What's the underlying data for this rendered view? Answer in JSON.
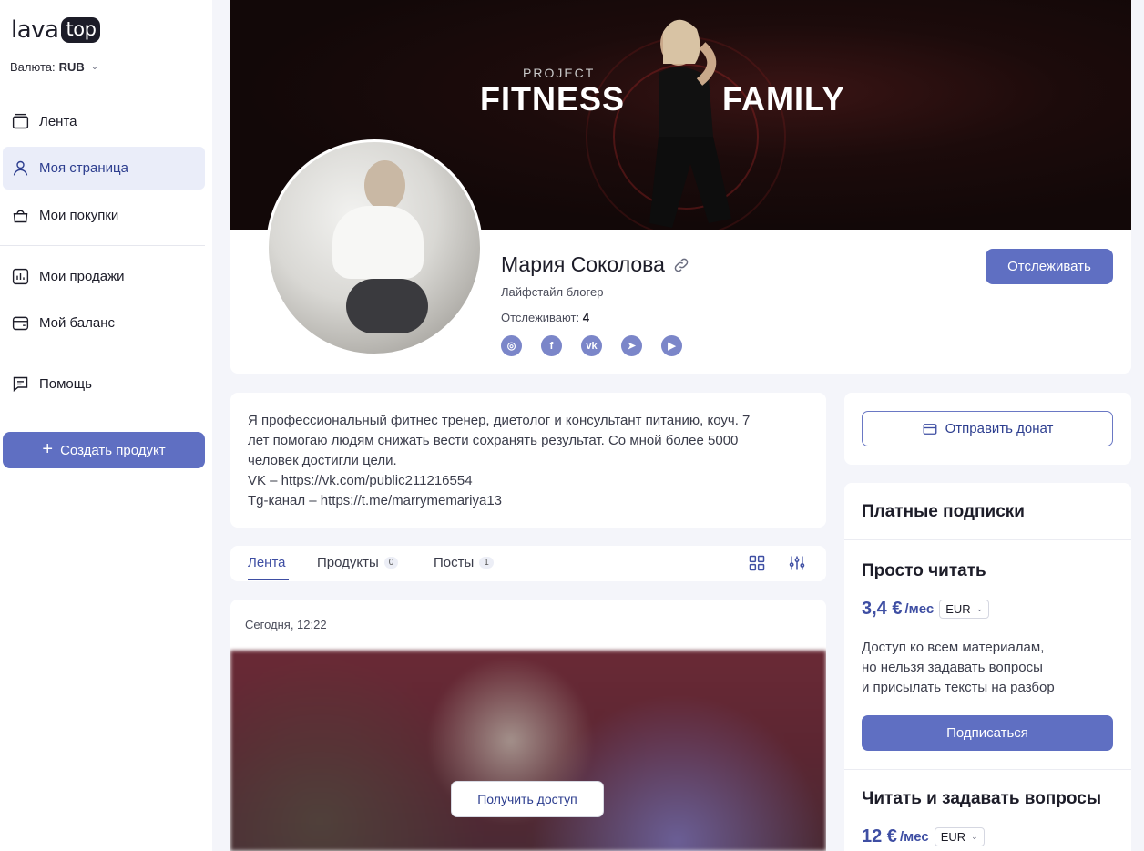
{
  "brand": {
    "logo_text": "lava",
    "logo_badge": "top"
  },
  "currency": {
    "label": "Валюта:",
    "value": "RUB"
  },
  "sidebar": {
    "items": [
      {
        "label": "Лента",
        "icon": "feed-icon"
      },
      {
        "label": "Моя страница",
        "icon": "user-icon",
        "active": true
      },
      {
        "label": "Мои покупки",
        "icon": "bag-icon"
      },
      {
        "label": "Мои продажи",
        "icon": "chart-icon"
      },
      {
        "label": "Мой баланс",
        "icon": "wallet-icon"
      },
      {
        "label": "Помощь",
        "icon": "chat-icon"
      }
    ],
    "create_button": "Создать продукт"
  },
  "banner": {
    "line1": "PROJECT",
    "word1": "FITNESS",
    "word2": "FAMILY"
  },
  "profile": {
    "name": "Мария Соколова",
    "role": "Лайфстайл блогер",
    "followers_label": "Отслеживают:",
    "followers_count": "4",
    "follow_button": "Отслеживать",
    "socials": [
      {
        "name": "instagram-icon",
        "glyph": "◎"
      },
      {
        "name": "facebook-icon",
        "glyph": "f"
      },
      {
        "name": "vk-icon",
        "glyph": "vk"
      },
      {
        "name": "telegram-icon",
        "glyph": "➤"
      },
      {
        "name": "youtube-icon",
        "glyph": "▶"
      }
    ]
  },
  "about": {
    "lines": [
      "Я профессиональный фитнес тренер, диетолог и консультант питанию, коуч. 7",
      "лет помогаю людям снижать вести сохранять результат. Со мной более 5000",
      "человек достигли цели.",
      "VK – https://vk.com/public211216554",
      "Tg-канал – https://t.me/marrymemariya13"
    ]
  },
  "tabs": [
    {
      "label": "Лента",
      "count": ""
    },
    {
      "label": "Продукты",
      "count": "0"
    },
    {
      "label": "Посты",
      "count": "1"
    }
  ],
  "post": {
    "date": "Сегодня, 12:22",
    "access_button": "Получить доступ"
  },
  "donate": {
    "button": "Отправить донат"
  },
  "subscriptions": {
    "title": "Платные подписки",
    "plans": [
      {
        "name": "Просто читать",
        "price": "3,4 €",
        "period": "/мес",
        "currency": "EUR",
        "description": [
          "Доступ ко всем материалам,",
          "но нельзя задавать вопросы",
          "и присылать тексты на разбор"
        ],
        "button": "Подписаться"
      },
      {
        "name": "Читать и задавать вопросы",
        "price": "12 €",
        "period": "/мес",
        "currency": "EUR"
      }
    ]
  },
  "colors": {
    "accent": "#5f6fc2",
    "accent_text": "#3e4ea3",
    "background": "#f4f5fa"
  }
}
